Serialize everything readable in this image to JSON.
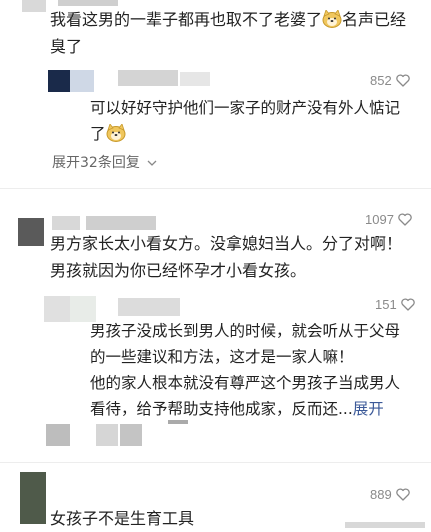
{
  "comments": [
    {
      "text_line1": "我看这男的一辈子都再也取不了老婆了",
      "text_line1_after_emoji": "名声已经",
      "text_line2": "臭了",
      "reply": {
        "likes": "852",
        "line1": "可以好好守护他们一家子的财产没有外人惦记",
        "line2": "了"
      },
      "more_replies": "展开32条回复"
    },
    {
      "likes": "1097",
      "line1": "男方家长太小看女方。没拿媳妇当人。分了对啊！",
      "line2": "男孩就因为你已经怀孕才小看女孩。",
      "reply": {
        "likes": "151",
        "line1": "男孩子没成长到男人的时候，就会听从于父母",
        "line2": "的一些建议和方法，这才是一家人嘛！",
        "line3": "他的家人根本就没有尊严这个男孩子当成男人",
        "line4": "看待，给予帮助支持他成家，反而还...",
        "expand": "展开"
      }
    },
    {
      "likes": "889",
      "line1": "女孩子不是生育工具"
    }
  ],
  "icons": {
    "heart": "heart-outline-icon",
    "emoji": "doge-emoji-icon",
    "chevron": "chevron-down-icon"
  }
}
